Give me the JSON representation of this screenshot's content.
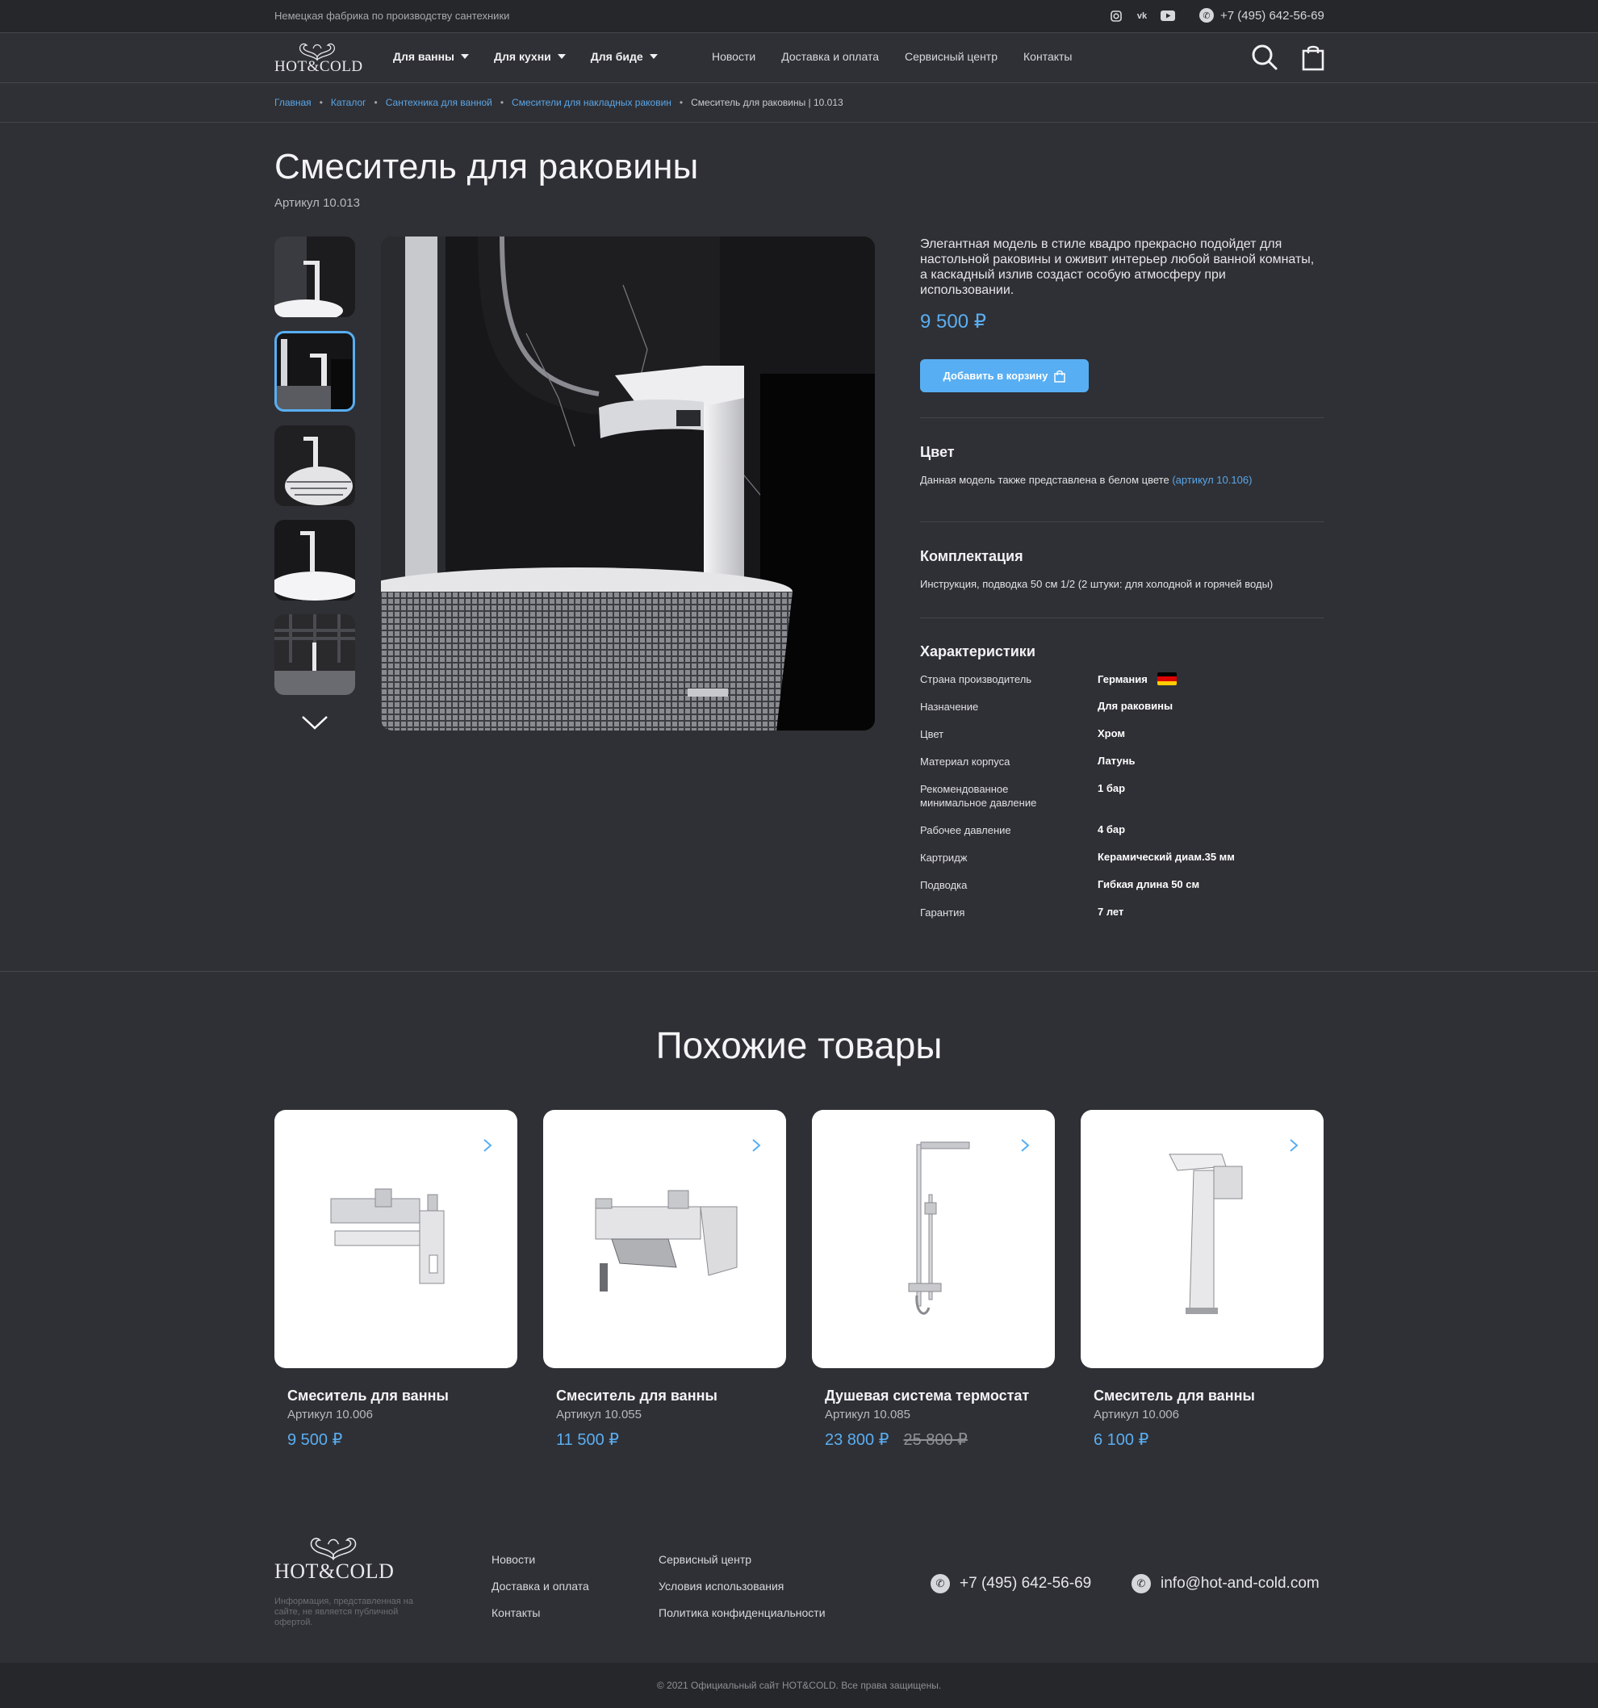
{
  "topbar": {
    "tagline": "Немецкая фабрика по производству сантехники",
    "phone": "+7 (495) 642-56-69",
    "socials": [
      "instagram-icon",
      "vk-icon",
      "youtube-icon"
    ]
  },
  "brand": {
    "logo_text": "HOT&COLD"
  },
  "nav": {
    "dropdowns": [
      "Для ванны",
      "Для кухни",
      "Для биде"
    ],
    "links": [
      "Новости",
      "Доставка и оплата",
      "Сервисный центр",
      "Контакты"
    ]
  },
  "breadcrumbs": {
    "links": [
      "Главная",
      "Каталог",
      "Сантехника для ванной",
      "Смесители для накладных раковин"
    ],
    "current": "Смеситель для раковины | 10.013"
  },
  "product": {
    "title": "Смеситель для раковины",
    "sku": "Артикул 10.013",
    "description": "Элегантная модель в стиле квадро прекрасно подойдет для настольной раковины и оживит интерьер любой ванной комнаты, а каскадный излив создаст особую атмосферу при использовании.",
    "price": "9 500 ₽",
    "cart_label": "Добавить в корзину",
    "color_title": "Цвет",
    "color_text": "Данная модель также представлена в белом цвете ",
    "color_link": "(артикул 10.106)",
    "kit_title": "Комплектация",
    "kit_text": "Инструкция, подводка 50 см  1/2 (2 штуки: для холодной и горячей воды)",
    "specs_title": "Характеристики",
    "specs": [
      {
        "label": "Страна производитель",
        "value": "Германия"
      },
      {
        "label": "Назначение",
        "value": "Для раковины"
      },
      {
        "label": "Цвет",
        "value": "Хром"
      },
      {
        "label": "Материал корпуса",
        "value": "Латунь"
      },
      {
        "label": "Рекомендованное минимальное давление",
        "value": "1 бар"
      },
      {
        "label": "Рабочее давление",
        "value": "4 бар"
      },
      {
        "label": "Картридж",
        "value": "Керамический диам.35 мм"
      },
      {
        "label": "Подводка",
        "value": "Гибкая длина 50 см"
      },
      {
        "label": "Гарантия",
        "value": "7 лет"
      }
    ]
  },
  "similar": {
    "title": "Похожие товары",
    "items": [
      {
        "name": "Смеситель для ванны",
        "sku": "Артикул 10.006",
        "price": "9 500 ₽",
        "old_price": ""
      },
      {
        "name": "Смеситель для ванны",
        "sku": "Артикул 10.055",
        "price": "11 500 ₽",
        "old_price": ""
      },
      {
        "name": "Душевая система термостат",
        "sku": "Артикул 10.085",
        "price": "23 800 ₽",
        "old_price": "25 800 ₽"
      },
      {
        "name": "Смеситель для ванны",
        "sku": "Артикул 10.006",
        "price": "6 100 ₽",
        "old_price": ""
      }
    ]
  },
  "footer": {
    "note": "Информация, представленная на сайте, не является публичной офертой.",
    "col1": [
      "Новости",
      "Доставка и оплата",
      "Контакты"
    ],
    "col2": [
      "Сервисный центр",
      "Условия использования",
      "Политика конфиденциальности"
    ],
    "phone": "+7 (495) 642-56-69",
    "email": "info@hot-and-cold.com",
    "copyright": "© 2021  Официальный сайт HOT&COLD. Все права защищены."
  },
  "colors": {
    "accent": "#58aef2",
    "background": "#2f3035",
    "bar": "#26272b"
  }
}
